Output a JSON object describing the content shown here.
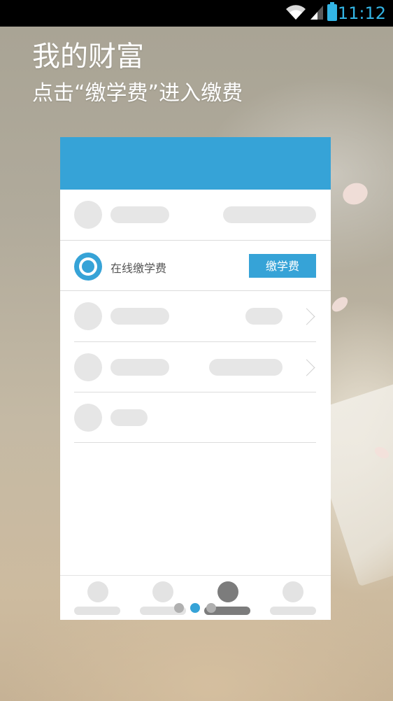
{
  "status_bar": {
    "time": "11:12",
    "icons": [
      "wifi-icon",
      "signal-icon",
      "battery-icon"
    ],
    "accent": "#33b5e5"
  },
  "guide": {
    "title": "我的财富",
    "subtitle": "点击“缴学费”进入缴费"
  },
  "card": {
    "header_color": "#36a3d7",
    "tuition_row": {
      "label": "在线缴学费",
      "button_label": "缴学费",
      "icon": "ring-icon"
    }
  },
  "pager": {
    "page_count": 3,
    "active_index": 1,
    "active_color": "#36a3d7",
    "inactive_color": "#b0b0b0"
  }
}
